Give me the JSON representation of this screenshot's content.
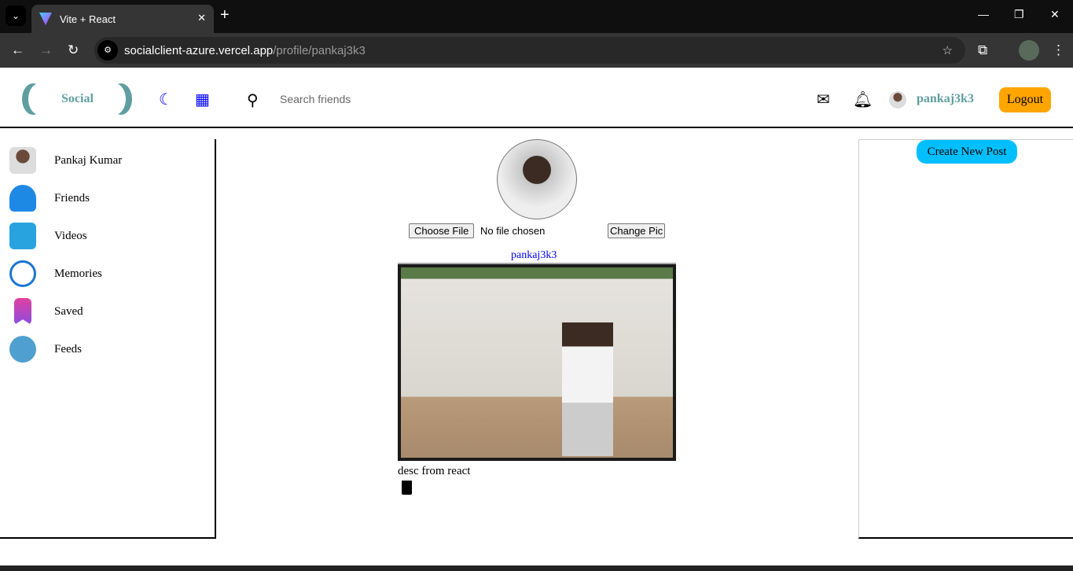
{
  "browser": {
    "tab_title": "Vite + React",
    "url_host": "socialclient-azure.vercel.app",
    "url_path": "/profile/pankaj3k3"
  },
  "header": {
    "brand": "Social",
    "search_placeholder": "Search friends",
    "username": "pankaj3k3",
    "logout": "Logout"
  },
  "sidebar": {
    "items": [
      {
        "label": "Pankaj Kumar",
        "color": "#888"
      },
      {
        "label": "Friends",
        "color": "#1e88e5"
      },
      {
        "label": "Videos",
        "color": "#29a3e0"
      },
      {
        "label": "Memories",
        "color": "#1976d2"
      },
      {
        "label": "Saved",
        "color": "#a64de0"
      },
      {
        "label": "Feeds",
        "color": "#4fa0d0"
      }
    ]
  },
  "profile": {
    "choose_file": "Choose File",
    "no_file": "No file chosen",
    "change_pic": "Change Pic"
  },
  "post": {
    "username": "pankaj3k3",
    "description": "desc from react"
  },
  "rightbar": {
    "create_post": "Create New Post"
  }
}
